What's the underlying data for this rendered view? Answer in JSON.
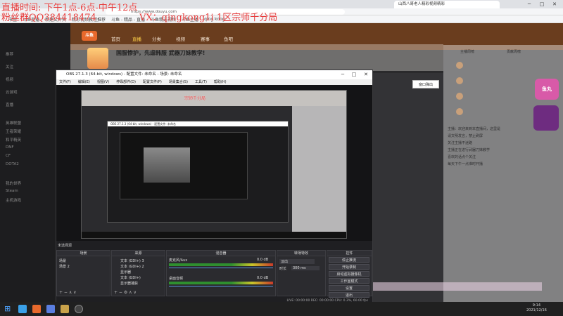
{
  "overlay": {
    "line1": "直播时间: 下午1点-6点-中午12点",
    "line2": "粉丝群QQ384418474",
    "vx": "VX：qingkong1i",
    "rank": "1区宗师千分局",
    "mini_rank": "宗师千分局"
  },
  "browser": {
    "url": "https://www.douyu.com",
    "tab_right": "山西八哥老人精彩视频精彩",
    "bookmarks": [
      "书签",
      "斗鱼直播",
      "新建文件夹",
      "精彩视频教程推荐",
      "斗鱼 - 精品 - 直播",
      "斗鱼精选视频",
      "斗鱼主播",
      "qing kong"
    ]
  },
  "site": {
    "logo": "斗鱼",
    "nav": [
      "首页",
      "直播",
      "分类",
      "视频",
      "赛事",
      "鱼吧"
    ],
    "room_title": "国服惨护，先虐韩服 武器刀妹教学!",
    "sidebar_items": [
      "推荐",
      "关注",
      "视频",
      "云游戏",
      "直播",
      "英雄联盟",
      "王者荣耀",
      "和平精英",
      "DNF",
      "CF",
      "DOTA2",
      "我的世界",
      "Steam",
      "主机游戏"
    ]
  },
  "right_panel": {
    "tabs": [
      "主播周榜",
      "贡献周榜"
    ],
    "chat_lines": [
      "主播：欢迎来到本直播间，这里是",
      "请文明发言，禁止刷屏",
      "关注主播不迷路",
      "主播正在进行武器刀妹教学",
      "喜欢的话点个关注",
      "每天下午一点准时开播"
    ],
    "gift_badge": "鱼丸"
  },
  "popup": {
    "label": "窗口弹出"
  },
  "obs": {
    "title": "OBS 27.1.3 (64-bit, windows) - 配置文件: 未命名 - 场景: 未命名",
    "menu": [
      "文件(F)",
      "编辑(E)",
      "视图(V)",
      "停靠部件(D)",
      "配置文件(P)",
      "场景集合(S)",
      "工具(T)",
      "帮助(H)"
    ],
    "inner_title": "OBS 27.1.3 (64-bit, windows) - 配置文件: 未命名",
    "docks_label": "未选择源",
    "scenes": {
      "header": "场景",
      "items": [
        "场景",
        "场景 2"
      ]
    },
    "sources": {
      "header": "来源",
      "items": [
        "文本 (GDI+) 3",
        "文本 (GDI+) 2",
        "显示器",
        "文本 (GDI+)",
        "显示器捕获"
      ]
    },
    "mixer": {
      "header": "混音器",
      "ch1": "麦克风/Aux",
      "ch1_db": "0.0 dB",
      "ch2": "桌面音频",
      "ch2_db": "0.0 dB"
    },
    "transitions": {
      "header": "转场特效",
      "type": "淡出",
      "duration_label": "时长",
      "duration": "300 ms"
    },
    "controls": {
      "header": "控件",
      "buttons": [
        "停止推流",
        "开始录制",
        "启动虚拟摄像机",
        "工作室模式",
        "设置",
        "退出"
      ]
    },
    "status": "LIVE: 00:00:00   REC: 00:00:00   CPU: 0.3%, 60.00 fps"
  },
  "taskbar": {
    "time": "9:14",
    "date": "2021/12/16"
  },
  "colors": {
    "obs_bg": "#1f1f22",
    "site_header": "#6a3d1e",
    "overlay_red": "#e63c3c"
  }
}
